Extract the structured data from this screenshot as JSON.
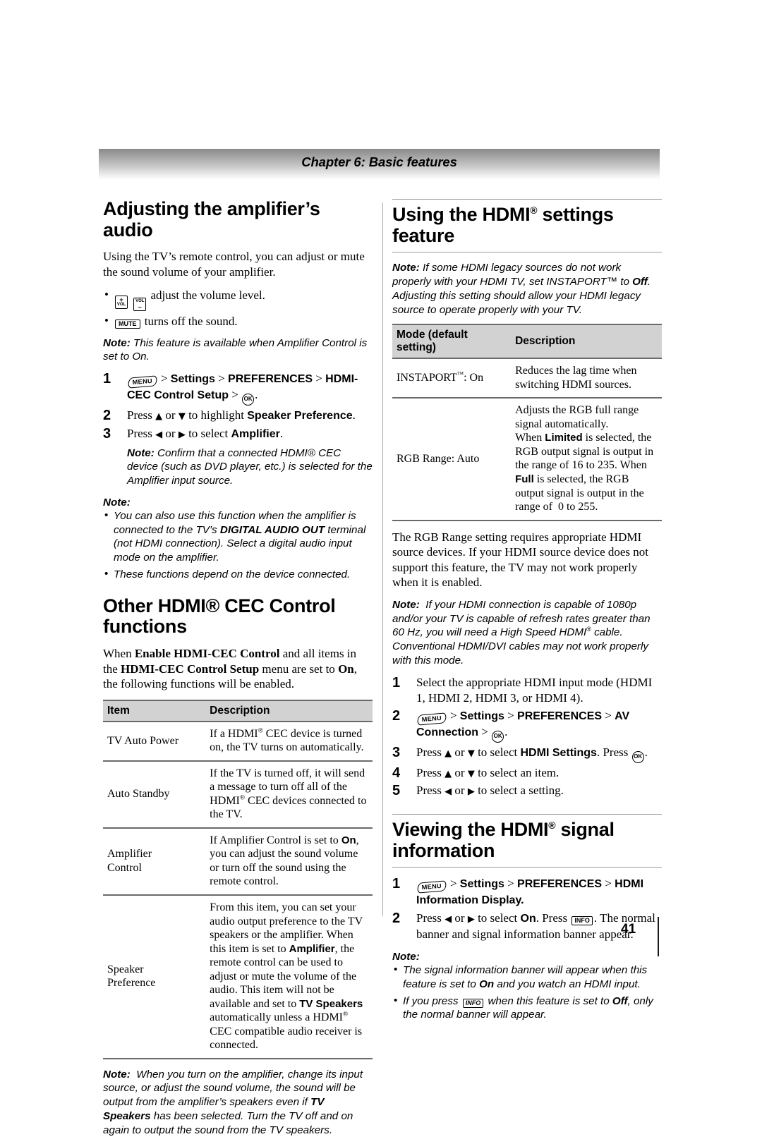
{
  "header": {
    "chapter": "Chapter 6: Basic features"
  },
  "page": {
    "number": "41"
  },
  "left": {
    "h_amp": "Adjusting the amplifier’s audio",
    "intro": "Using the TV’s remote control, you can adjust or mute the sound volume of your amplifier.",
    "bullet_vol": "adjust the volume level.",
    "bullet_mute": "turns off the sound.",
    "note_label": "Note:",
    "note_amp": "This feature is available when Amplifier Control is set to On.",
    "step1_a": "> ",
    "step1_settings": "Settings",
    "step1_prefs": "PREFERENCES",
    "step1_hdmicec": "HDMI-CEC Control Setup",
    "step2_pre": "Press",
    "step2_mid": "or",
    "step2_post": "to highlight",
    "step2_bold": "Speaker Preference",
    "step3_pre": "Press",
    "step3_mid": "or",
    "step3_post": "to select",
    "step3_bold": "Amplifier",
    "step3_note": "Confirm that a connected HDMI® CEC device (such as DVD player, etc.) is selected for the Amplifier input source.",
    "note_head": "Note:",
    "note_b1_a": "You can also use this function when the amplifier is connected to the TV’s ",
    "note_b1_bold": "DIGITAL AUDIO OUT",
    "note_b1_b": " terminal (not HDMI connection). Select a digital audio input mode on the amplifier.",
    "note_b2": "These functions depend on the device connected.",
    "h_other": "Other HDMI® CEC Control functions",
    "other_p_a": "When ",
    "other_p_b1": "Enable HDMI-CEC Control",
    "other_p_b": " and all items in the ",
    "other_p_b2": "HDMI-CEC Control Setup",
    "other_p_c": " menu are set to ",
    "other_p_b3": "On",
    "other_p_d": ", the following functions will be enabled.",
    "table": {
      "headers": [
        "Item",
        "Description"
      ],
      "rows": [
        {
          "item": "TV Auto Power",
          "desc": "If a HDMI® CEC device is turned on, the TV turns on automatically."
        },
        {
          "item": "Auto Standby",
          "desc": "If the TV is turned off, it will send a message to turn off all of the HDMI® CEC devices connected to the TV."
        },
        {
          "item": "Amplifier Control",
          "desc": "If Amplifier Control is set to On, you can adjust the sound volume or turn off the sound using the remote control."
        },
        {
          "item": "Speaker Preference",
          "desc": "From this item, you can set your audio output preference to the TV speakers or the amplifier. When this item is set to Amplifier, the remote control can be used to adjust or mute the volume of the audio. This item will not be available and set to TV Speakers automatically unless a HDMI® CEC compatible audio receiver is connected."
        }
      ]
    },
    "bottom_note_label": "Note:",
    "bottom_note_a": "When you turn on the amplifier, change its input source, or adjust the sound volume, the sound will be output from the amplifier’s speakers even if ",
    "bottom_note_bold": "TV Speakers",
    "bottom_note_b": " has been selected. Turn the TV off and on again to output the sound from the TV speakers."
  },
  "right": {
    "h_using": "Using the HDMI® settings feature",
    "note_label": "Note:",
    "note_legacy_a": "If some HDMI legacy sources do not work properly with your HDMI TV, set INSTAPORT™ to ",
    "note_legacy_bold": "Off",
    "note_legacy_b": ". Adjusting this setting should allow your HDMI legacy source to operate properly with your TV.",
    "table": {
      "headers": [
        "Mode (default setting)",
        "Description"
      ],
      "rows": [
        {
          "mode": "INSTAPORT™: On",
          "desc": "Reduces the lag time when switching HDMI sources."
        },
        {
          "mode": "RGB Range: Auto",
          "desc": "Adjusts the RGB full range signal automatically. When Limited is selected, the RGB output signal is output in the range of 16 to 235. When Full is selected, the RGB output signal is output in the range of  0 to 255."
        }
      ]
    },
    "rgb_para": "The RGB Range setting requires appropriate HDMI source devices. If your HDMI source device does not support this feature, the TV may not work properly when it is enabled.",
    "note_speed_label": "Note:",
    "note_speed": "If your HDMI connection is capable of 1080p and/or your TV is capable of refresh rates greater than 60 Hz, you will need a High Speed HDMI® cable. Conventional HDMI/DVI cables may not work properly with this mode.",
    "step1": "Select the appropriate HDMI input mode (HDMI 1, HDMI 2, HDMI 3, or HDMI 4).",
    "step2_settings": "Settings",
    "step2_prefs": "PREFERENCES",
    "step2_av": "AV Connection",
    "step3_pre": "Press",
    "step3_mid": "or",
    "step3_post": "to select",
    "step3_bold": "HDMI Settings",
    "step3_press": ". Press",
    "step4": "to select an item.",
    "step4_pre": "Press",
    "step4_mid": "or",
    "step5_pre": "Press",
    "step5_mid": "or",
    "step5_post": "to select a setting.",
    "h_viewing": "Viewing the HDMI® signal information",
    "v_step1_settings": "Settings",
    "v_step1_prefs": "PREFERENCES",
    "v_step1_hdmi": "HDMI Information Display",
    "v_step2_pre": "Press",
    "v_step2_mid": "or",
    "v_step2_post": "to select",
    "v_step2_bold": "On",
    "v_step2_press": ". Press",
    "v_step2_tail": ". The normal banner and signal information banner appear.",
    "note_head": "Note:",
    "note_b1_a": "The signal information banner will appear when this feature is set to ",
    "note_b1_bold": "On",
    "note_b1_b": " and you watch an HDMI input.",
    "note_b2_a": "If you press ",
    "note_b2_b": " when this feature is set to ",
    "note_b2_bold": "Off",
    "note_b2_c": ", only the normal banner will appear."
  },
  "icons": {
    "menu": "MENU",
    "ok": "OK",
    "info": "INFO",
    "mute": "MUTE",
    "vol": "VOL",
    "plus": "+",
    "minus": "–",
    "up": "▲",
    "down": "▼",
    "left": "◀",
    "right": "▶"
  }
}
